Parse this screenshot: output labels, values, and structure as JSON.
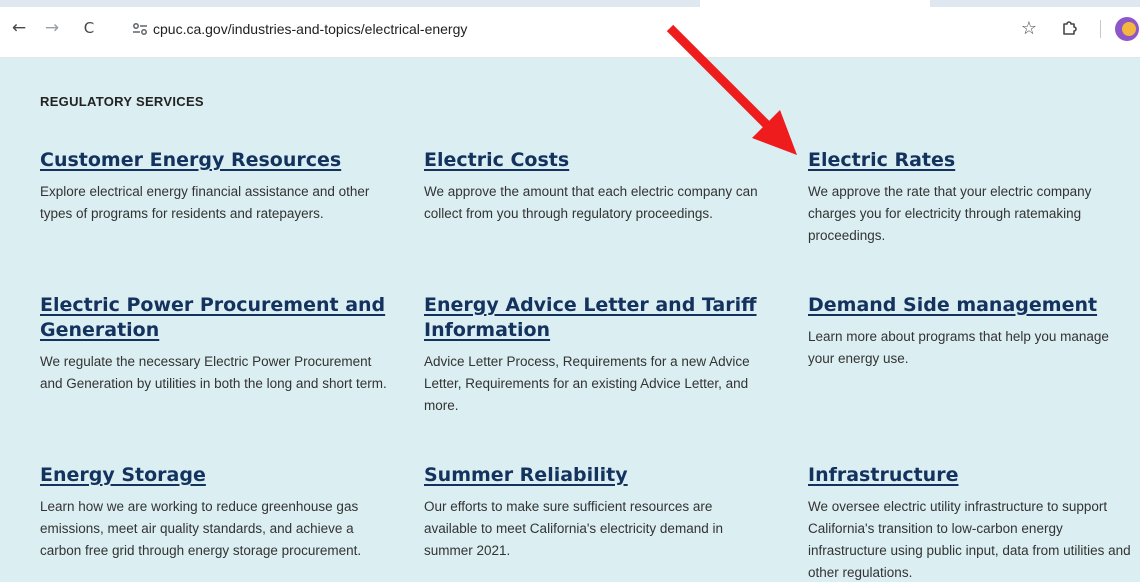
{
  "browser": {
    "back_icon": "←",
    "forward_icon": "→",
    "reload_icon": "C",
    "site_info_icon": "site-info-icon",
    "url": "cpuc.ca.gov/industries-and-topics/electrical-energy",
    "star_icon": "☆"
  },
  "page": {
    "section_heading": "REGULATORY SERVICES",
    "background_color": "#dbeef2",
    "link_color": "#13325e",
    "cards": [
      {
        "title": "Customer Energy Resources",
        "description": "Explore electrical energy financial assistance and other types of programs for residents and ratepayers."
      },
      {
        "title": "Electric Costs",
        "description": "We approve the amount that each electric company can collect from you through regulatory proceedings."
      },
      {
        "title": "Electric Rates",
        "description": "We approve the rate that your electric company charges you for electricity through ratemaking proceedings."
      },
      {
        "title": "Electric Power Procurement and Generation",
        "description": "We regulate the necessary Electric Power Procurement and Generation by utilities in both the long and short term."
      },
      {
        "title": "Energy Advice Letter and Tariff Information",
        "description": "Advice Letter Process, Requirements for a new Advice Letter, Requirements for an existing Advice Letter, and more."
      },
      {
        "title": "Demand Side management",
        "description": "Learn more about programs that help you manage your energy use."
      },
      {
        "title": "Energy Storage",
        "description": "Learn how we are working to reduce greenhouse gas emissions, meet air quality standards, and achieve a carbon free grid through energy storage procurement."
      },
      {
        "title": "Summer Reliability",
        "description": "Our efforts to make sure sufficient resources are available to meet California's electricity demand in summer 2021."
      },
      {
        "title": "Infrastructure",
        "description": "We oversee electric utility infrastructure to support California's transition to low-carbon energy infrastructure using public input, data from utilities and other regulations."
      }
    ]
  },
  "annotation": {
    "arrow_color": "#ee1c1c"
  }
}
